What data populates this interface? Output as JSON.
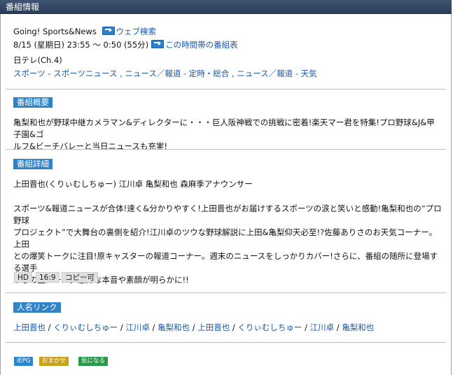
{
  "header": {
    "title": "番組情報"
  },
  "program": {
    "title": "Going!  Sports&News",
    "web_search": "ウェブ検索",
    "datetime": "8/15 (星期日) 23:55 ～ 0:50 (55分)",
    "timeslot_link": "この時間帯の番組表",
    "channel": "日テレ(Ch.4)",
    "genres": "スポーツ - スポーツニュース , ニュース／報道 - 定時・総合 , ニュース／報道 - 天気"
  },
  "summary": {
    "label": "番組概要",
    "line1": "亀梨和也が野球中継カメラマン&ディレクターに・・・巨人阪神戦での挑戦に密着!楽天マー君を特集!プロ野球&J&甲子園&ゴ",
    "line2": "ルフ&ビーチバレーと当日ニュースも充実!"
  },
  "details": {
    "label": "番組詳細",
    "cast": "上田晋也(くりぃむしちゅー)  江川卓   亀梨和也   森麻季アナウンサー",
    "line1": "スポーツ&報道ニュースが合体!速く&分かりやすく!上田晋也がお届けするスポーツの涙と笑いと感動!亀梨和也の“プロ野球",
    "line2": "プロジェクト”で大舞台の裏側を紹介!江川卓のツウな野球解説に上田&亀梨仰天必至!?佐藤ありさのお天気コーナー。上田",
    "line3": "との爆笑トークに注目!原キャスターの報道コーナー。週末のニュースをしっかりカバー!さらに、番組の随所に登場する選手",
    "line4": "からの生メール。意外な本音や素顔が明らかに!!",
    "tags": [
      "HD",
      "16:9",
      "コピー可"
    ]
  },
  "people": {
    "label": "人名リンク",
    "links": [
      "上田晋也",
      "くりぃむしちゅー",
      "江川卓",
      "亀梨和也",
      "上田晋也",
      "くりぃむしちゅー",
      "江川卓",
      "亀梨和也"
    ],
    "separator": "/"
  },
  "footer_buttons": {
    "iepg": "iEPG",
    "omakase": "おまかせ",
    "kininaru": "気になる"
  },
  "colors": {
    "titlebar": "#34486a",
    "badge": "#2f83c9",
    "link": "#1c58a8",
    "iepg": "#2f83c9",
    "omakase": "#c8a21a",
    "kininaru": "#2a9a4a"
  }
}
